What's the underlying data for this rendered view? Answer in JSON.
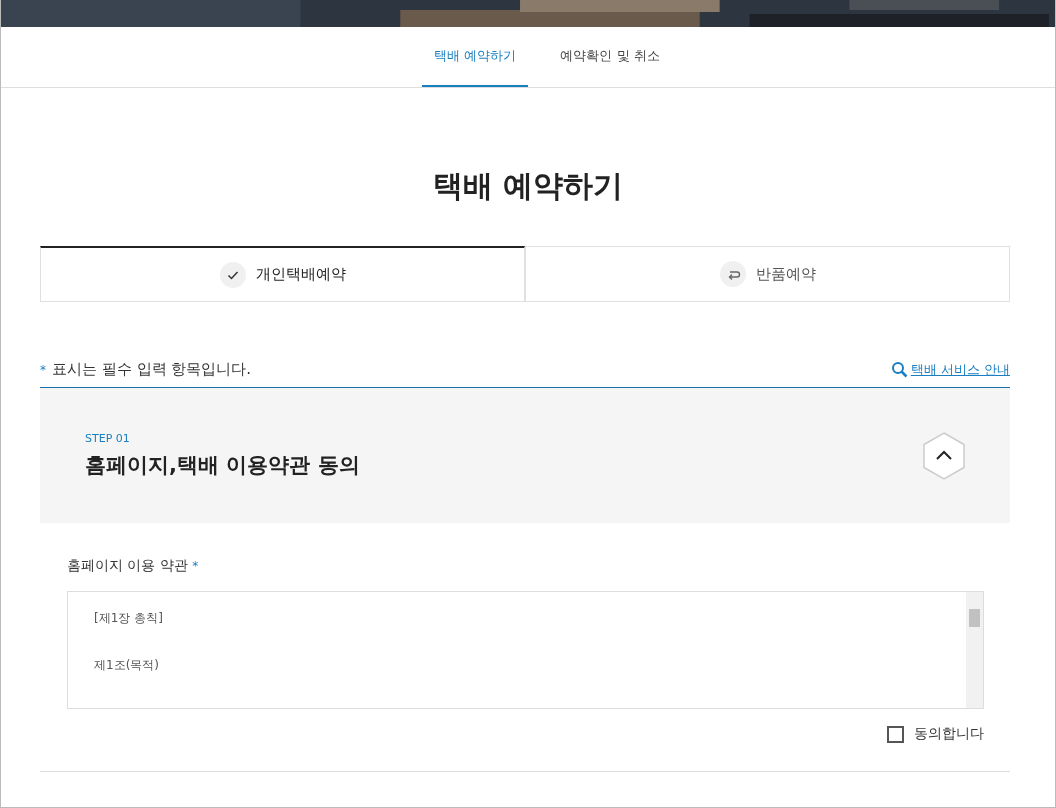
{
  "nav_tabs": [
    {
      "label": "택배 예약하기",
      "selected": true
    },
    {
      "label": "예약확인 및 취소",
      "selected": false
    }
  ],
  "page_title": "택배 예약하기",
  "type_tabs": [
    {
      "label": "개인택배예약",
      "kind": "check",
      "selected": true
    },
    {
      "label": "반품예약",
      "kind": "return",
      "selected": false
    }
  ],
  "required_note": {
    "mark": "*",
    "text": "표시는 필수 입력 항목입니다."
  },
  "service_link": "택배 서비스 안내",
  "step": {
    "number": "STEP 01",
    "title": "홈페이지,택배 이용약관 동의",
    "expanded": true
  },
  "terms": {
    "label": "홈페이지 이용 약관",
    "mark": "*",
    "lines": [
      "[제1장 총칙]",
      "제1조(목적)"
    ]
  },
  "agree": {
    "label": "동의합니다",
    "checked": false
  }
}
